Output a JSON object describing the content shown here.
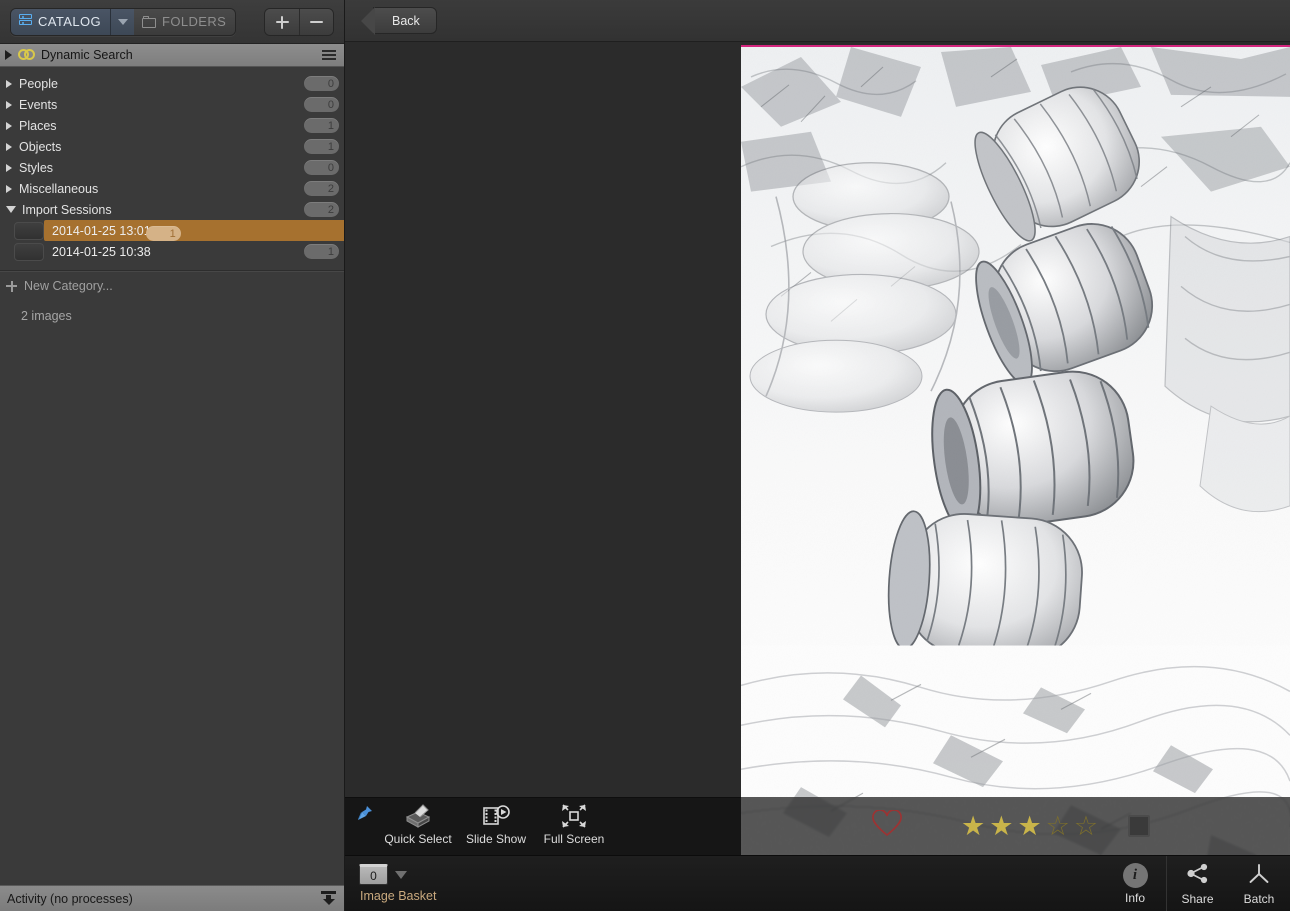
{
  "sidebar": {
    "tabs": [
      {
        "label": "CATALOG",
        "icon": "catalog-icon",
        "active": true
      },
      {
        "label": "FOLDERS",
        "icon": "folder-icon",
        "active": false
      }
    ],
    "add_button": "+",
    "remove_button": "−",
    "header": {
      "label": "Dynamic Search",
      "icon": "dynamic-search-icon",
      "menu_icon": "hamburger-icon"
    },
    "tree": [
      {
        "label": "People",
        "count": "0",
        "expanded": false
      },
      {
        "label": "Events",
        "count": "0",
        "expanded": false
      },
      {
        "label": "Places",
        "count": "1",
        "expanded": false
      },
      {
        "label": "Objects",
        "count": "1",
        "expanded": false
      },
      {
        "label": "Styles",
        "count": "0",
        "expanded": false
      },
      {
        "label": "Miscellaneous",
        "count": "2",
        "expanded": false
      },
      {
        "label": "Import Sessions",
        "count": "2",
        "expanded": true
      }
    ],
    "sessions": [
      {
        "label": "2014-01-25 13:01",
        "count": "1",
        "selected": true
      },
      {
        "label": "2014-01-25 10:38",
        "count": "1",
        "selected": false
      }
    ],
    "new_category": "New Category...",
    "image_count": "2 images",
    "activity": "Activity (no processes)"
  },
  "main": {
    "back_button": "Back",
    "toolbar": [
      {
        "label": "Quick Select",
        "icon": "quick-select-icon"
      },
      {
        "label": "Slide Show",
        "icon": "slide-show-icon"
      },
      {
        "label": "Full Screen",
        "icon": "full-screen-icon"
      }
    ],
    "pin_icon": "pin-icon",
    "rating": {
      "heart_icon": "heart-icon",
      "stars_filled": 3,
      "stars_total": 5,
      "color_label": "none"
    },
    "photo": {
      "alt": "High-key overexposed photograph of carved stone ruins and columns",
      "border_color": "#d4257e"
    }
  },
  "status": {
    "basket_count": "0",
    "basket_label": "Image Basket",
    "items": [
      {
        "label": "Info",
        "icon": "info-icon"
      },
      {
        "label": "Share",
        "icon": "share-icon"
      },
      {
        "label": "Batch",
        "icon": "batch-icon"
      }
    ]
  },
  "colors": {
    "selection": "#a6712f",
    "accent": "#5aaef0",
    "star": "#c9b44a",
    "photo_border": "#d4257e"
  }
}
